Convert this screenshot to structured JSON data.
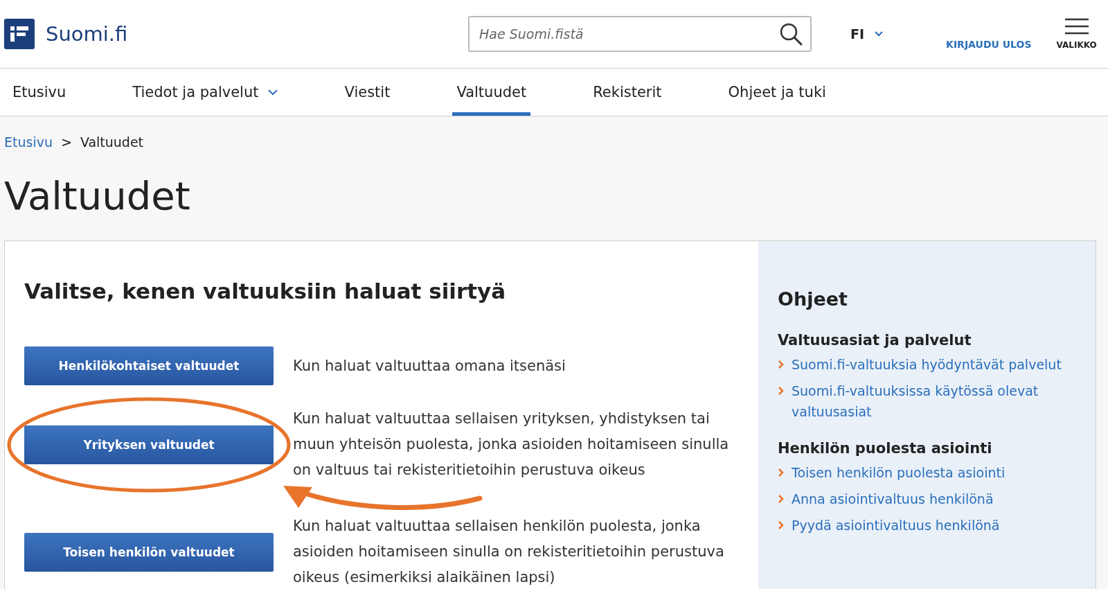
{
  "header": {
    "logo_text": "Suomi.fi",
    "search": {
      "placeholder": "Hae Suomi.fistä"
    },
    "language": "FI",
    "logout": "KIRJAUDU ULOS",
    "menu": "VALIKKO"
  },
  "nav": [
    {
      "label": "Etusivu",
      "selected": false,
      "dropdown": false
    },
    {
      "label": "Tiedot ja palvelut",
      "selected": false,
      "dropdown": true
    },
    {
      "label": "Viestit",
      "selected": false,
      "dropdown": false
    },
    {
      "label": "Valtuudet",
      "selected": true,
      "dropdown": false
    },
    {
      "label": "Rekisterit",
      "selected": false,
      "dropdown": false
    },
    {
      "label": "Ohjeet ja tuki",
      "selected": false,
      "dropdown": false
    }
  ],
  "breadcrumb": {
    "link": "Etusivu",
    "separator": ">",
    "current": "Valtuudet"
  },
  "page_title": "Valtuudet",
  "main": {
    "heading": "Valitse, kenen valtuuksiin haluat siirtyä",
    "options": [
      {
        "button": "Henkilökohtaiset valtuudet",
        "description": "Kun haluat valtuuttaa omana itsenäsi",
        "highlighted": false
      },
      {
        "button": "Yrityksen valtuudet",
        "description": "Kun haluat valtuuttaa sellaisen yrityksen, yhdistyksen tai muun yhteisön puolesta, jonka asioiden hoitamiseen sinulla on valtuus tai rekisteritietoihin perustuva oikeus",
        "highlighted": true
      },
      {
        "button": "Toisen henkilön valtuudet",
        "description": "Kun haluat valtuuttaa sellaisen henkilön puolesta, jonka asioiden hoitamiseen sinulla on rekisteritietoihin perustuva oikeus (esimerkiksi alaikäinen lapsi)",
        "highlighted": false
      }
    ]
  },
  "sidebar": {
    "title": "Ohjeet",
    "sections": [
      {
        "heading": "Valtuusasiat ja palvelut",
        "links": [
          "Suomi.fi-valtuuksia hyödyntävät palvelut",
          "Suomi.fi-valtuuksissa käytössä olevat valtuusasiat"
        ]
      },
      {
        "heading": "Henkilön puolesta asiointi",
        "links": [
          "Toisen henkilön puolesta asiointi",
          "Anna asiointivaltuus henkilönä",
          "Pyydä asiointivaltuus henkilönä"
        ]
      }
    ]
  }
}
